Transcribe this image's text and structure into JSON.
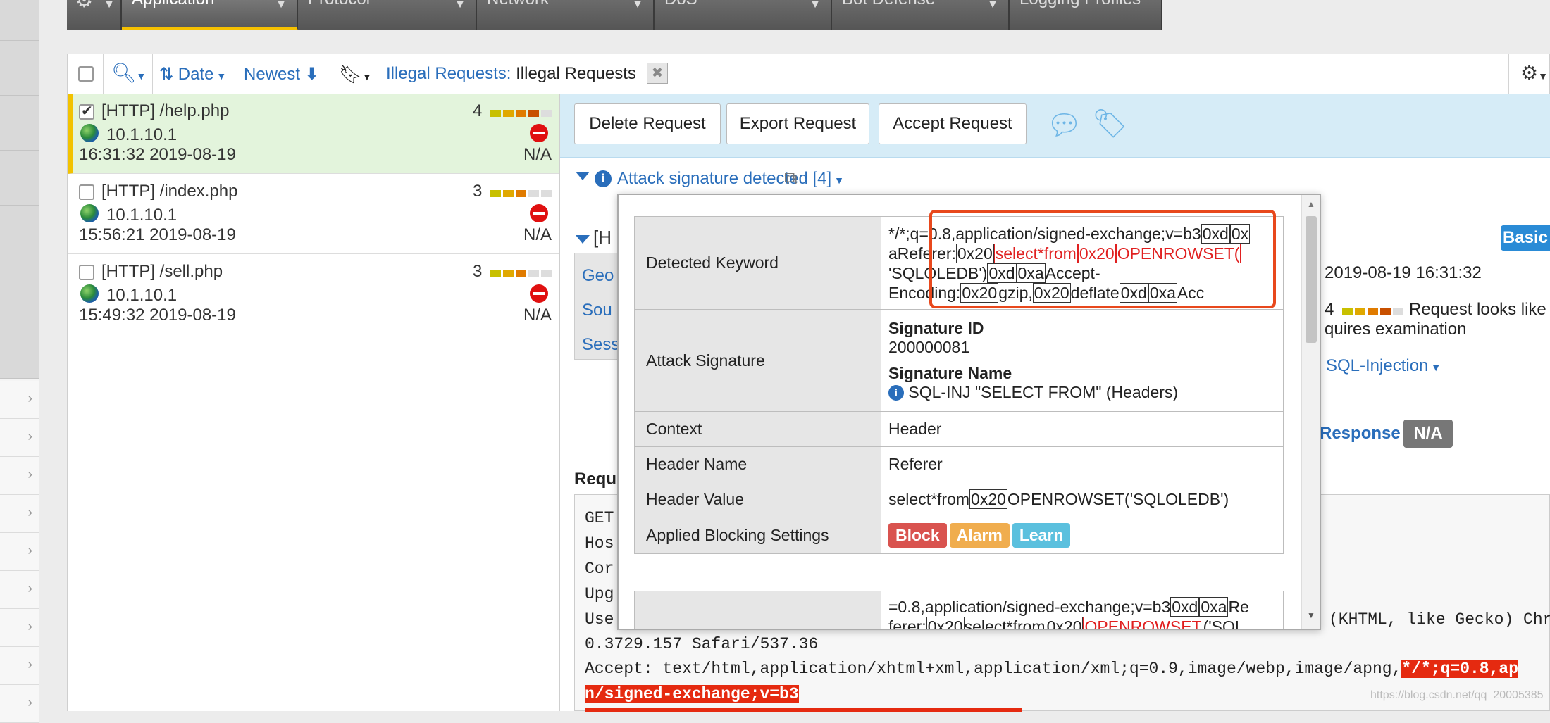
{
  "nav": {
    "tabs": [
      {
        "label": "Application"
      },
      {
        "label": "Protocol"
      },
      {
        "label": "Network"
      },
      {
        "label": "DoS"
      },
      {
        "label": "Bot Defense"
      },
      {
        "label": "Logging Profiles"
      }
    ]
  },
  "toolbar": {
    "sort_label": "Date",
    "order_label": "Newest",
    "filter_prefix": "Illegal Requests:",
    "filter_value": "Illegal Requests",
    "close_glyph": "✖"
  },
  "requests": [
    {
      "path": "[HTTP] /help.php",
      "ip": "10.1.10.1",
      "timestamp": "16:31:32 2019-08-19",
      "score": "4",
      "response": "N/A",
      "checked": true
    },
    {
      "path": "[HTTP] /index.php",
      "ip": "10.1.10.1",
      "timestamp": "15:56:21 2019-08-19",
      "score": "3",
      "response": "N/A",
      "checked": false
    },
    {
      "path": "[HTTP] /sell.php",
      "ip": "10.1.10.1",
      "timestamp": "15:49:32 2019-08-19",
      "score": "3",
      "response": "N/A",
      "checked": false
    }
  ],
  "actions": {
    "delete": "Delete Request",
    "export": "Export Request",
    "accept": "Accept Request"
  },
  "detail": {
    "violation": "Attack signature detected [4]",
    "section_fragment": "[H",
    "badge_basic": "Basic",
    "time": "2019-08-19 16:31:32",
    "score": "4",
    "looks_like": "Request looks like",
    "requires": "quires examination",
    "attack_type": "SQL-Injection",
    "response_label": "Response",
    "response_value": "N/A",
    "side_labels": [
      "Geo",
      "Sou",
      "Sess"
    ],
    "request_label": "Requ",
    "header_fragments": [
      "GET",
      "Hos",
      "Cor",
      "Upg",
      "Use"
    ],
    "ua_tail": "(KHTML, like Gecko) Chr",
    "line1": "0.3729.157 Safari/537.36",
    "line2_plain": "Accept: text/html,application/xhtml+xml,application/xml;q=0.9,image/webp,image/apng,",
    "line2_hl": "*/*;q=0.8,ap",
    "line3_hl": "n/signed-exchange;v=b3",
    "watermark": "https://blog.csdn.net/qq_20005385"
  },
  "popup": {
    "rows": {
      "detected_keyword": "Detected Keyword",
      "attack_signature": "Attack Signature",
      "context": "Context",
      "header_name": "Header Name",
      "header_value": "Header Value",
      "blocking": "Applied Blocking Settings"
    },
    "keyword": {
      "p1": "*/*;q=0.8,application/signed-exchange;v=b3",
      "t_0xd": "0xd",
      "t_0x": "0x",
      "p2": "a",
      "p3": "Referer:",
      "t_0x20": "0x20",
      "r1": "select*from",
      "r2": "0x20",
      "r3": "OPENROWSET(",
      "p4": "'SQLOLEDB')",
      "t_0xa": "0xa",
      "p5": "Accept-",
      "p6": "Encoding:",
      "p7": "gzip,",
      "p8": "deflate",
      "p9": "Acc"
    },
    "signature_id_label": "Signature ID",
    "signature_id": "200000081",
    "signature_name_label": "Signature Name",
    "signature_name": "SQL-INJ \"SELECT FROM\" (Headers)",
    "context": "Header",
    "header_name": "Referer",
    "header_value_a": "select*from",
    "header_value_b": "0x20",
    "header_value_c": "OPENROWSET('SQLOLEDB')",
    "blocking": {
      "block": "Block",
      "alarm": "Alarm",
      "learn": "Learn"
    },
    "colors": {
      "block": "#d9534f",
      "alarm": "#f0ad4e",
      "learn": "#5bc0de"
    },
    "second": {
      "l1a": "=0.8,application/signed-exchange;v=b3",
      "l1b": "0xd",
      "l1c": "0xa",
      "l1d": "Re",
      "l2a": "ferer:",
      "l2b": "0x20",
      "l2c": "select*from",
      "l2d": "0x20",
      "l2e": "OPENROWSET",
      "l2f": "('SQL"
    }
  }
}
